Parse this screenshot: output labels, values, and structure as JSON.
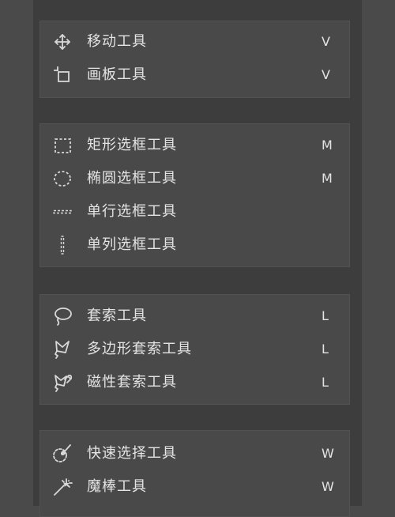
{
  "tool_groups": [
    {
      "name": "move-artboard-group",
      "tools": [
        {
          "label": "移动工具",
          "shortcut": "V",
          "icon": "move-icon"
        },
        {
          "label": "画板工具",
          "shortcut": "V",
          "icon": "artboard-icon"
        }
      ]
    },
    {
      "name": "marquee-group",
      "tools": [
        {
          "label": "矩形选框工具",
          "shortcut": "M",
          "icon": "rectangular-marquee-icon"
        },
        {
          "label": "椭圆选框工具",
          "shortcut": "M",
          "icon": "elliptical-marquee-icon"
        },
        {
          "label": "单行选框工具",
          "shortcut": "",
          "icon": "single-row-marquee-icon"
        },
        {
          "label": "单列选框工具",
          "shortcut": "",
          "icon": "single-column-marquee-icon"
        }
      ]
    },
    {
      "name": "lasso-group",
      "tools": [
        {
          "label": "套索工具",
          "shortcut": "L",
          "icon": "lasso-icon"
        },
        {
          "label": "多边形套索工具",
          "shortcut": "L",
          "icon": "polygonal-lasso-icon"
        },
        {
          "label": "磁性套索工具",
          "shortcut": "L",
          "icon": "magnetic-lasso-icon"
        }
      ]
    },
    {
      "name": "selection-group",
      "tools": [
        {
          "label": "快速选择工具",
          "shortcut": "W",
          "icon": "quick-selection-icon"
        },
        {
          "label": "魔棒工具",
          "shortcut": "W",
          "icon": "magic-wand-icon"
        }
      ]
    }
  ]
}
